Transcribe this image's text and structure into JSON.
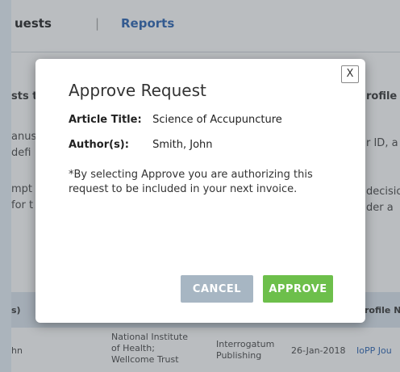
{
  "tabs": {
    "requests": "uests",
    "separator": "|",
    "reports": "Reports"
  },
  "background": {
    "left_heading": "sts t",
    "left_lines": [
      "anus",
      "defi",
      "mpt",
      "for t"
    ],
    "right_heading": "rofile",
    "right_lines": [
      "r ID, a",
      "decisio",
      "der a"
    ],
    "table_header_left": "s)",
    "table_header_right": "rofile N",
    "row": {
      "name": "hn",
      "funder": [
        "National Institute",
        "of Health;",
        "Wellcome Trust"
      ],
      "publisher": [
        "Interrogatum",
        "Publishing"
      ],
      "date": "26-Jan-2018",
      "profile": "IoPP Jou"
    }
  },
  "modal": {
    "close_label": "X",
    "title": "Approve Request",
    "article_title_label": "Article Title:",
    "article_title_value": "Science of Accupuncture",
    "authors_label": "Author(s):",
    "authors_value": "Smith, John",
    "notice": "*By selecting Approve you are authorizing this request to be included in your next invoice.",
    "cancel_label": "CANCEL",
    "approve_label": "APPROVE"
  },
  "colors": {
    "link": "#3a6fb8",
    "approve": "#6dbf4b",
    "cancel": "#a7b6c3",
    "table_header": "#dfe8f1"
  }
}
